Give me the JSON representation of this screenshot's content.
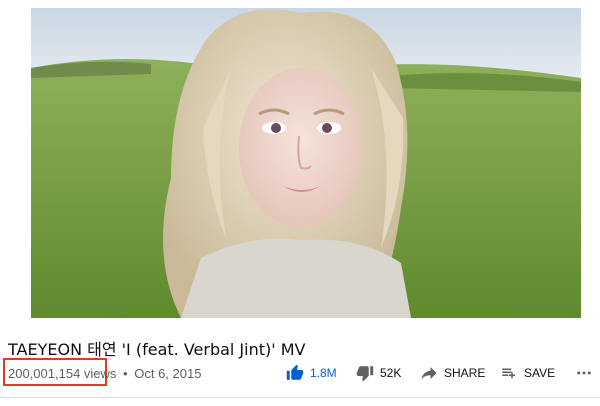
{
  "video": {
    "title": "TAEYEON 태연 'I (feat. Verbal Jint)' MV",
    "views": "200,001,154 views",
    "separator": "•",
    "date": "Oct 6, 2015"
  },
  "actions": {
    "like_count": "1.8M",
    "dislike_count": "52K",
    "share_label": "SHARE",
    "save_label": "SAVE"
  },
  "colors": {
    "accent": "#065fd4",
    "highlight_box": "#e03b24",
    "meta_text": "#606060"
  },
  "icons": [
    "thumb-up-icon",
    "thumb-down-icon",
    "share-icon",
    "save-playlist-icon",
    "more-icon"
  ]
}
